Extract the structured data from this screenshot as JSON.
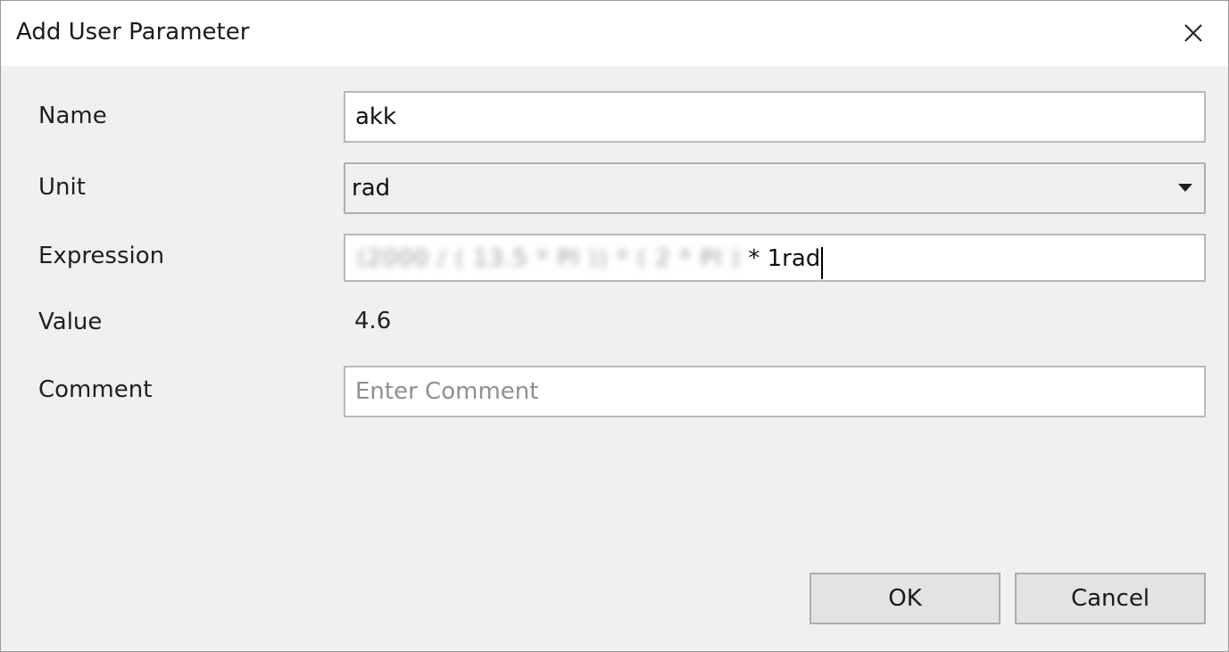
{
  "dialog": {
    "title": "Add User Parameter",
    "close_icon": "close-icon"
  },
  "form": {
    "name": {
      "label": "Name",
      "value": "akk"
    },
    "unit": {
      "label": "Unit",
      "value": "rad",
      "icon": "chevron-down-icon"
    },
    "expression": {
      "label": "Expression",
      "redacted_prefix": "(2000 / ( 13.5 * PI )) * ( 2 * PI )",
      "visible_suffix": "* 1rad"
    },
    "value": {
      "label": "Value",
      "value": "4.6"
    },
    "comment": {
      "label": "Comment",
      "placeholder": "Enter Comment",
      "value": ""
    }
  },
  "buttons": {
    "ok": "OK",
    "cancel": "Cancel"
  }
}
